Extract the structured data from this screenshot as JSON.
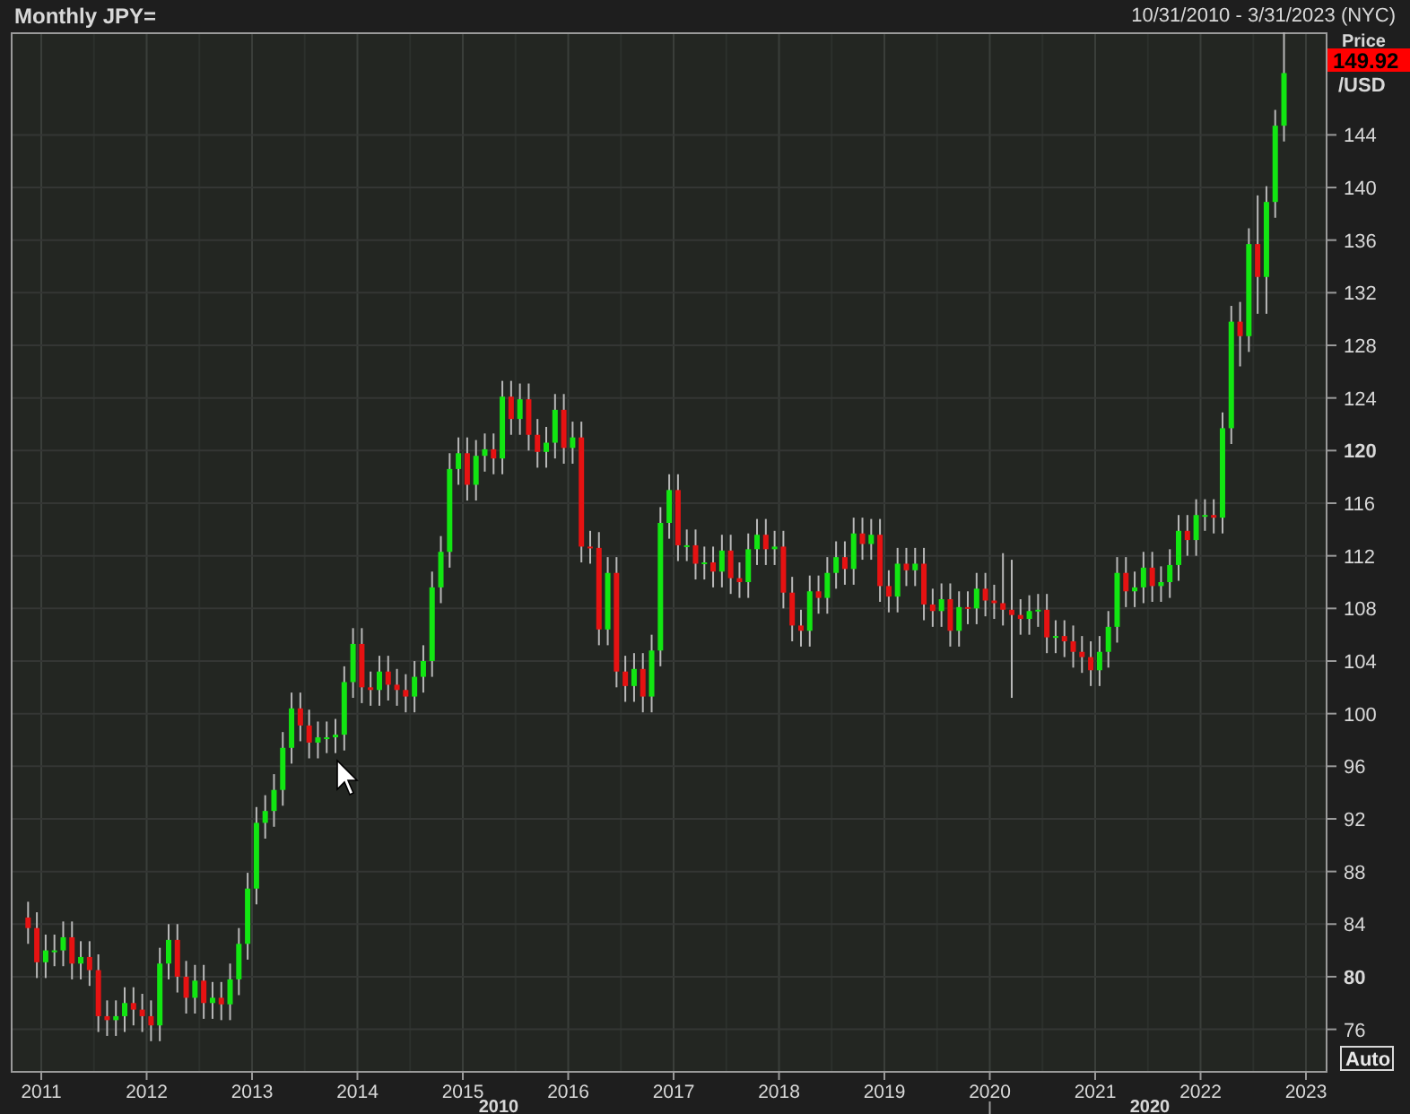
{
  "header": {
    "title": "Monthly JPY=",
    "date_range": "10/31/2010 - 3/31/2023 (NYC)"
  },
  "price_axis": {
    "caption_top": "Price",
    "caption_bottom": "/USD",
    "last_price": "149.92",
    "auto_button": "Auto"
  },
  "chart": {
    "chart_data": {
      "type": "candlestick",
      "grid": true,
      "ylim": [
        72.7,
        151.8
      ],
      "yticks": [
        144,
        140,
        136,
        132,
        128,
        124,
        120,
        116,
        112,
        108,
        104,
        100,
        96,
        92,
        88,
        84,
        80,
        76
      ],
      "categories": [
        null,
        null,
        null,
        null,
        null,
        null,
        null,
        null,
        null,
        null,
        null,
        null,
        null,
        null,
        null,
        null,
        null,
        null,
        null,
        null,
        null,
        null,
        null,
        null,
        null,
        null,
        null,
        null,
        null,
        null,
        null,
        null,
        null,
        null,
        null,
        null,
        null,
        null,
        null,
        null,
        null,
        null,
        null,
        null,
        null,
        null,
        null,
        null,
        null,
        null,
        null,
        null,
        null,
        null,
        null,
        null,
        null,
        null,
        null,
        null,
        null,
        null,
        null,
        null,
        null,
        null,
        null,
        null,
        null,
        null,
        null,
        null,
        null,
        null,
        null,
        null,
        null,
        null,
        null,
        null,
        null,
        null,
        null,
        null,
        null,
        null,
        null,
        null,
        null,
        null,
        null,
        null,
        null,
        null,
        null,
        null,
        null,
        null,
        null,
        null,
        null,
        null,
        null,
        null,
        null,
        null,
        null,
        null,
        null,
        null,
        null,
        null,
        null,
        null,
        null,
        null,
        null,
        null,
        null,
        null,
        null,
        null,
        null,
        null,
        null,
        null,
        null,
        null,
        null,
        null,
        null,
        null,
        null,
        null,
        null,
        null,
        null,
        null,
        null,
        null,
        null,
        null,
        null,
        null
      ],
      "ohlc": [
        [
          84.5,
          85.7,
          82.5,
          83.7
        ],
        [
          83.7,
          84.9,
          79.9,
          81.1
        ],
        [
          81.1,
          83.2,
          79.9,
          82
        ],
        [
          82,
          83.2,
          80.8,
          82
        ],
        [
          82,
          84.2,
          80.8,
          83
        ],
        [
          83,
          84.2,
          79.8,
          81
        ],
        [
          81,
          82.7,
          79.8,
          81.5
        ],
        [
          81.5,
          82.7,
          79.3,
          80.5
        ],
        [
          80.5,
          81.7,
          75.8,
          77
        ],
        [
          77,
          78.2,
          75.5,
          76.7
        ],
        [
          76.7,
          78.2,
          75.5,
          77
        ],
        [
          77,
          79.2,
          75.8,
          78
        ],
        [
          78,
          79.2,
          76.3,
          77.5
        ],
        [
          77.5,
          78.7,
          75.8,
          77
        ],
        [
          77,
          78.2,
          75.1,
          76.3
        ],
        [
          76.3,
          82.2,
          75.1,
          81
        ],
        [
          81,
          84,
          79.8,
          82.8
        ],
        [
          82.8,
          84,
          78.8,
          80
        ],
        [
          80,
          81.2,
          77.2,
          78.4
        ],
        [
          78.4,
          80.9,
          77.2,
          79.7
        ],
        [
          79.7,
          80.9,
          76.8,
          78
        ],
        [
          78,
          79.6,
          76.8,
          78.4
        ],
        [
          78.4,
          79.6,
          76.7,
          77.9
        ],
        [
          77.9,
          81,
          76.7,
          79.8
        ],
        [
          79.8,
          83.7,
          78.6,
          82.5
        ],
        [
          82.5,
          87.9,
          81.3,
          86.7
        ],
        [
          86.7,
          92.9,
          85.5,
          91.7
        ],
        [
          91.7,
          93.8,
          90.5,
          92.6
        ],
        [
          92.6,
          95.4,
          91.4,
          94.2
        ],
        [
          94.2,
          98.6,
          93,
          97.4
        ],
        [
          97.4,
          101.6,
          96.2,
          100.4
        ],
        [
          100.4,
          101.6,
          97.9,
          99.1
        ],
        [
          99.1,
          100.3,
          96.6,
          97.8
        ],
        [
          97.8,
          99.4,
          96.6,
          98.2
        ],
        [
          98.2,
          99.4,
          97,
          98.2
        ],
        [
          98.2,
          99.6,
          97,
          98.4
        ],
        [
          98.4,
          103.6,
          97.2,
          102.4
        ],
        [
          102.4,
          106.5,
          101.2,
          105.3
        ],
        [
          105.3,
          106.5,
          100.8,
          102
        ],
        [
          102,
          103.2,
          100.6,
          101.8
        ],
        [
          101.8,
          104.4,
          100.6,
          103.2
        ],
        [
          103.2,
          104.4,
          101,
          102.2
        ],
        [
          102.2,
          103.4,
          100.6,
          101.8
        ],
        [
          101.8,
          103,
          100.1,
          101.3
        ],
        [
          101.3,
          104,
          100.1,
          102.8
        ],
        [
          102.8,
          105.2,
          101.6,
          104
        ],
        [
          104,
          110.8,
          102.8,
          109.6
        ],
        [
          109.6,
          113.5,
          108.4,
          112.3
        ],
        [
          112.3,
          119.8,
          111.1,
          118.6
        ],
        [
          118.6,
          121,
          117.4,
          119.8
        ],
        [
          119.8,
          121,
          116.2,
          117.4
        ],
        [
          117.4,
          120.8,
          116.2,
          119.6
        ],
        [
          119.6,
          121.3,
          118.4,
          120.1
        ],
        [
          120.1,
          121.3,
          118.2,
          119.4
        ],
        [
          119.4,
          125.3,
          118.2,
          124.1
        ],
        [
          124.1,
          125.3,
          121.2,
          122.4
        ],
        [
          122.4,
          125.1,
          121.2,
          123.9
        ],
        [
          123.9,
          125.1,
          120,
          121.2
        ],
        [
          121.2,
          122.4,
          118.7,
          119.9
        ],
        [
          119.9,
          121.8,
          118.7,
          120.6
        ],
        [
          120.6,
          124.3,
          119.4,
          123.1
        ],
        [
          123.1,
          124.3,
          119,
          120.2
        ],
        [
          120.2,
          122.2,
          119,
          121
        ],
        [
          121,
          122.2,
          111.5,
          112.7
        ],
        [
          112.7,
          113.9,
          111.4,
          112.6
        ],
        [
          112.6,
          113.8,
          105.2,
          106.4
        ],
        [
          106.4,
          111.9,
          105.2,
          110.7
        ],
        [
          110.7,
          111.9,
          102,
          103.2
        ],
        [
          103.2,
          104.4,
          100.9,
          102.1
        ],
        [
          102.1,
          104.6,
          100.9,
          103.4
        ],
        [
          103.4,
          104.6,
          100.1,
          101.3
        ],
        [
          101.3,
          106,
          100.1,
          104.8
        ],
        [
          104.8,
          115.7,
          103.6,
          114.5
        ],
        [
          114.5,
          118.2,
          113.3,
          117
        ],
        [
          117,
          118.2,
          111.6,
          112.8
        ],
        [
          112.8,
          114,
          111.6,
          112.8
        ],
        [
          112.8,
          114,
          110.2,
          111.4
        ],
        [
          111.4,
          112.7,
          110.2,
          111.5
        ],
        [
          111.5,
          112.7,
          109.6,
          110.8
        ],
        [
          110.8,
          113.6,
          109.6,
          112.4
        ],
        [
          112.4,
          113.6,
          109.1,
          110.3
        ],
        [
          110.3,
          111.5,
          108.8,
          110
        ],
        [
          110,
          113.7,
          108.8,
          112.5
        ],
        [
          112.5,
          114.8,
          111.3,
          113.6
        ],
        [
          113.6,
          114.8,
          111.3,
          112.5
        ],
        [
          112.5,
          113.9,
          111.3,
          112.7
        ],
        [
          112.7,
          113.9,
          108,
          109.2
        ],
        [
          109.2,
          110.4,
          105.5,
          106.7
        ],
        [
          106.7,
          107.9,
          105.1,
          106.3
        ],
        [
          106.3,
          110.5,
          105.1,
          109.3
        ],
        [
          109.3,
          110.5,
          107.6,
          108.8
        ],
        [
          108.8,
          111.9,
          107.6,
          110.7
        ],
        [
          110.7,
          113.1,
          109.5,
          111.9
        ],
        [
          111.9,
          113.1,
          109.8,
          111
        ],
        [
          111,
          114.9,
          109.8,
          113.7
        ],
        [
          113.7,
          114.9,
          111.7,
          112.9
        ],
        [
          112.9,
          114.8,
          111.7,
          113.6
        ],
        [
          113.6,
          114.8,
          108.5,
          109.7
        ],
        [
          109.7,
          110.9,
          107.7,
          108.9
        ],
        [
          108.9,
          112.6,
          107.7,
          111.4
        ],
        [
          111.4,
          112.6,
          109.7,
          110.9
        ],
        [
          110.9,
          112.6,
          109.7,
          111.4
        ],
        [
          111.4,
          112.6,
          107.1,
          108.3
        ],
        [
          108.3,
          109.5,
          106.6,
          107.8
        ],
        [
          107.8,
          109.9,
          106.6,
          108.7
        ],
        [
          108.7,
          109.9,
          105.1,
          106.3
        ],
        [
          106.3,
          109.3,
          105.1,
          108.1
        ],
        [
          108.1,
          109.3,
          106.8,
          108
        ],
        [
          108,
          110.7,
          106.8,
          109.5
        ],
        [
          109.5,
          110.7,
          107.4,
          108.6
        ],
        [
          108.6,
          109.8,
          107.2,
          108.4
        ],
        [
          108.4,
          112.2,
          106.7,
          107.9
        ],
        [
          107.9,
          111.7,
          101.2,
          107.5
        ],
        [
          107.5,
          108.7,
          106,
          107.2
        ],
        [
          107.2,
          109,
          106,
          107.8
        ],
        [
          107.8,
          109.1,
          106.6,
          107.9
        ],
        [
          107.9,
          109.1,
          104.6,
          105.8
        ],
        [
          105.8,
          107.1,
          104.6,
          105.9
        ],
        [
          105.9,
          107.1,
          104.3,
          105.5
        ],
        [
          105.5,
          106.7,
          103.5,
          104.7
        ],
        [
          104.7,
          105.9,
          103.1,
          104.3
        ],
        [
          104.3,
          105.5,
          102.1,
          103.3
        ],
        [
          103.3,
          105.9,
          102.1,
          104.7
        ],
        [
          104.7,
          107.8,
          103.5,
          106.6
        ],
        [
          106.6,
          111.9,
          105.4,
          110.7
        ],
        [
          110.7,
          111.9,
          108.1,
          109.3
        ],
        [
          109.3,
          110.8,
          108.1,
          109.6
        ],
        [
          109.6,
          112.3,
          108.4,
          111.1
        ],
        [
          111.1,
          112.3,
          108.5,
          109.7
        ],
        [
          109.7,
          111.2,
          108.5,
          110
        ],
        [
          110,
          112.5,
          108.8,
          111.3
        ],
        [
          111.3,
          115.1,
          110.1,
          113.9
        ],
        [
          113.9,
          115.1,
          112,
          113.2
        ],
        [
          113.2,
          116.3,
          112,
          115.1
        ],
        [
          115.1,
          116.3,
          113.9,
          115.1
        ],
        [
          115.1,
          116.3,
          113.7,
          114.9
        ],
        [
          114.9,
          122.9,
          113.7,
          121.7
        ],
        [
          121.7,
          131,
          120.5,
          129.8
        ],
        [
          129.8,
          131.3,
          126.4,
          128.7
        ],
        [
          128.7,
          136.9,
          127.5,
          135.7
        ],
        [
          135.7,
          139.4,
          130.4,
          133.2
        ],
        [
          133.2,
          140.1,
          130.4,
          138.9
        ],
        [
          138.9,
          145.9,
          137.7,
          144.7
        ],
        [
          144.7,
          151.9,
          143.5,
          148.7
        ]
      ]
    }
  },
  "time_axis": {
    "years": [
      "2011",
      "2012",
      "2013",
      "2014",
      "2015",
      "2016",
      "2017",
      "2018",
      "2019",
      "2020",
      "2021",
      "2022",
      "2023"
    ],
    "decades": [
      "2010",
      "2020"
    ]
  }
}
